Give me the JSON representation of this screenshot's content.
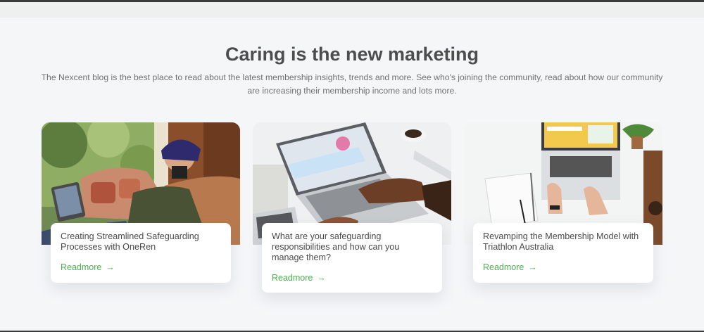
{
  "section": {
    "title": "Caring is the new marketing",
    "description": "The Nexcent blog is the best place to read about the latest membership insights, trends and more. See who's joining the community, read about how our community are increasing their membership income and lots more."
  },
  "cards": [
    {
      "title": "Creating Streamlined Safeguarding Processes with OneRen",
      "link_label": "Readmore",
      "arrow": "→"
    },
    {
      "title": "What are your safeguarding responsibilities and how can you manage them?",
      "link_label": "Readmore",
      "arrow": "→"
    },
    {
      "title": "Revamping the Membership Model with Triathlon Australia",
      "link_label": "Readmore",
      "arrow": "→"
    }
  ],
  "colors": {
    "accent": "#4caf4f",
    "heading": "#4d4d4d",
    "background": "#f4f6f8"
  }
}
